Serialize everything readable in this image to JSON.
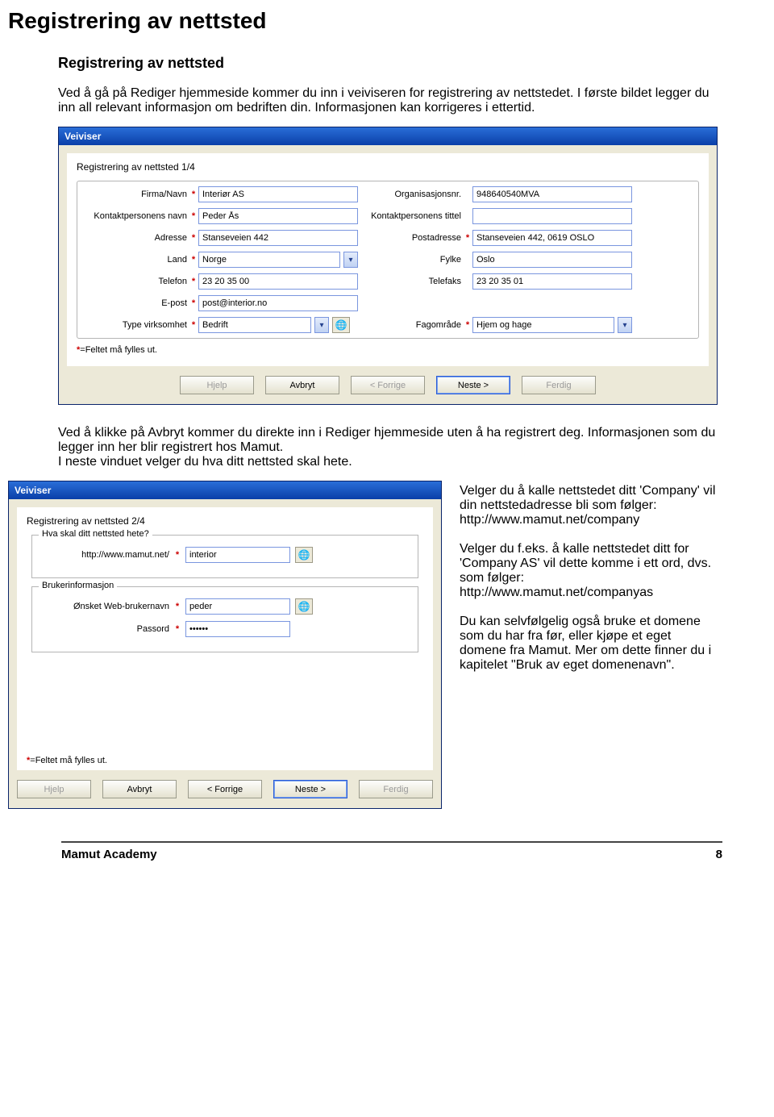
{
  "doc": {
    "title": "Registrering av nettsted",
    "section_title": "Registrering av nettsted",
    "intro": "Ved å gå på Rediger hjemmeside kommer du inn i veiviseren for registrering av nettstedet. I første bildet legger du inn all relevant informasjon om bedriften din. Informasjonen kan korrigeres i ettertid.",
    "mid_para": "Ved å klikke på Avbryt kommer du direkte inn i Rediger hjemmeside uten å ha registrert deg. Informasjonen som du legger inn her blir registrert hos Mamut.\nI neste vinduet velger du hva ditt nettsted skal hete.",
    "side": {
      "p1": "Velger du å kalle nettstedet ditt 'Company' vil din nettstedadresse bli som følger: http://www.mamut.net/company",
      "p2": "Velger du f.eks. å kalle nettstedet ditt for 'Company AS' vil dette komme i ett ord, dvs. som følger: http://www.mamut.net/companyas",
      "p3": "Du kan selvfølgelig også bruke et domene som du har fra før, eller kjøpe et eget domene fra Mamut. Mer om dette finner du i kapitelet \"Bruk av eget domenenavn\"."
    },
    "footer_left": "Mamut Academy",
    "footer_right": "8"
  },
  "dlg1": {
    "title": "Veiviser",
    "heading": "Registrering av nettsted 1/4",
    "footnote": "=Feltet  må fylles ut.",
    "labels": {
      "firma": "Firma/Navn",
      "orgnr": "Organisasjonsnr.",
      "kontaktnavn": "Kontaktpersonens navn",
      "kontakttittel": "Kontaktpersonens tittel",
      "adresse": "Adresse",
      "postadr": "Postadresse",
      "land": "Land",
      "fylke": "Fylke",
      "telefon": "Telefon",
      "telefaks": "Telefaks",
      "epost": "E-post",
      "type_virk": "Type virksomhet",
      "fagomrade": "Fagområde"
    },
    "values": {
      "firma": "Interiør AS",
      "orgnr": "948640540MVA",
      "kontaktnavn": "Peder Ås",
      "kontakttittel": "",
      "adresse": "Stanseveien 442",
      "postadr": "Stanseveien 442, 0619 OSLO",
      "land": "Norge",
      "fylke": "Oslo",
      "telefon": "23 20 35 00",
      "telefaks": "23 20 35 01",
      "epost": "post@interior.no",
      "type_virk": "Bedrift",
      "fagomrade": "Hjem og hage"
    },
    "buttons": {
      "help": "Hjelp",
      "cancel": "Avbryt",
      "prev": "< Forrige",
      "next": "Neste >",
      "finish": "Ferdig"
    }
  },
  "dlg2": {
    "title": "Veiviser",
    "heading": "Registrering av nettsted  2/4",
    "group1": "Hva skal ditt nettsted hete?",
    "urlprefix": "http://www.mamut.net/",
    "sitename": "interior",
    "group2": "Brukerinformasjon",
    "user_label": "Ønsket Web-brukernavn",
    "user_value": "peder",
    "pass_label": "Passord",
    "pass_value": "••••••",
    "footnote": "=Feltet  må fylles ut.",
    "buttons": {
      "help": "Hjelp",
      "cancel": "Avbryt",
      "prev": "< Forrige",
      "next": "Neste >",
      "finish": "Ferdig"
    }
  }
}
